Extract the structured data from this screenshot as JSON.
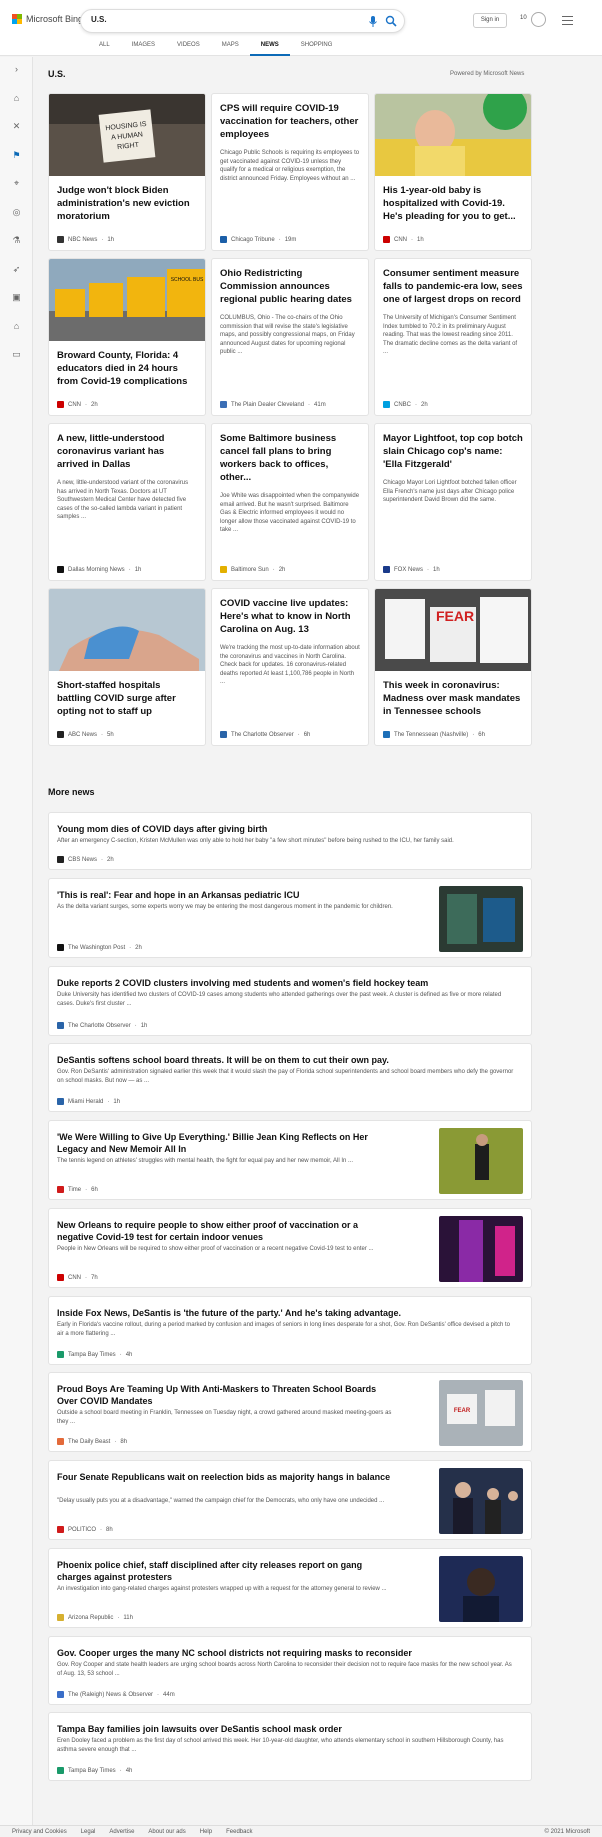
{
  "header": {
    "logo_text": "Microsoft Bing",
    "search_value": "U.S.",
    "signin_label": "Sign in",
    "points": "10"
  },
  "nav": [
    "ALL",
    "IMAGES",
    "VIDEOS",
    "MAPS",
    "NEWS",
    "SHOPPING"
  ],
  "nav_active": "NEWS",
  "section": {
    "title": "U.S.",
    "powered_by": "Powered by Microsoft News"
  },
  "cards": [
    {
      "title": "Judge won't block Biden administration's new eviction moratorium",
      "snippet": "",
      "source": "NBC News",
      "time": "1h"
    },
    {
      "title": "CPS will require COVID-19 vaccination for teachers, other employees",
      "snippet": "Chicago Public Schools is requiring its employees to get vaccinated against COVID-19 unless they qualify for a medical or religious exemption, the district announced Friday. Employees without an ...",
      "source": "Chicago Tribune",
      "time": "19m"
    },
    {
      "title": "His 1-year-old baby is hospitalized with Covid-19. He's pleading for you to get...",
      "snippet": "",
      "source": "CNN",
      "time": "1h"
    },
    {
      "title": "Broward County, Florida: 4 educators died in 24 hours from Covid-19 complications",
      "snippet": "",
      "source": "CNN",
      "time": "2h"
    },
    {
      "title": "Ohio Redistricting Commission announces regional public hearing dates",
      "snippet": "COLUMBUS, Ohio - The co-chairs of the Ohio commission that will revise the state's legislative maps, and possibly congressional maps, on Friday announced August dates for upcoming regional public ...",
      "source": "The Plain Dealer Cleveland",
      "time": "41m"
    },
    {
      "title": "Consumer sentiment measure falls to pandemic-era low, sees one of largest drops on record",
      "snippet": "The University of Michigan's Consumer Sentiment Index tumbled to 70.2 in its preliminary August reading. That was the lowest reading since 2011. The dramatic decline comes as the delta variant of ...",
      "source": "CNBC",
      "time": "2h"
    },
    {
      "title": "A new, little-understood coronavirus variant has arrived in Dallas",
      "snippet": "A new, little-understood variant of the coronavirus has arrived in North Texas. Doctors at UT Southwestern Medical Center have detected five cases of the so-called lambda variant in patient samples ...",
      "source": "Dallas Morning News",
      "time": "1h"
    },
    {
      "title": "Some Baltimore business cancel fall plans to bring workers back to offices, other...",
      "snippet": "Joe White was disappointed when the companywide email arrived. But he wasn't surprised. Baltimore Gas & Electric informed employees it would no longer allow those vaccinated against COVID-19 to take ...",
      "source": "Baltimore Sun",
      "time": "2h"
    },
    {
      "title": "Mayor Lightfoot, top cop botch slain Chicago cop's name: 'Ella Fitzgerald'",
      "snippet": "Chicago Mayor Lori Lightfoot botched fallen officer Ella French's name just days after Chicago police superintendent David Brown did the same.",
      "source": "FOX News",
      "time": "1h"
    },
    {
      "title": "Short-staffed hospitals battling COVID surge after opting not to staff up",
      "snippet": "",
      "source": "ABC News",
      "time": "5h"
    },
    {
      "title": "COVID vaccine live updates: Here's what to know in North Carolina on Aug. 13",
      "snippet": "We're tracking the most up-to-date information about the coronavirus and vaccines in North Carolina. Check back for updates. 16 coronavirus-related deaths reported At least 1,100,786 people in North ...",
      "source": "The Charlotte Observer",
      "time": "6h"
    },
    {
      "title": "This week in coronavirus: Madness over mask mandates in Tennessee schools",
      "snippet": "",
      "source": "The Tennessean (Nashville)",
      "time": "6h"
    }
  ],
  "images": {
    "sign_text": "HOUSING IS A HUMAN RIGHT",
    "bus_text": "SCHOOL BUS",
    "protest_text": "FEAR"
  },
  "more_news": {
    "title": "More news",
    "items": [
      {
        "title": "Young mom dies of COVID days after giving birth",
        "snippet": "After an emergency C-section, Kristen McMullen was only able to hold her baby \"a few short minutes\" before being rushed to the ICU, her family said.",
        "source": "CBS News",
        "time": "2h"
      },
      {
        "title": "'This is real': Fear and hope in an Arkansas pediatric ICU",
        "snippet": "As the delta variant surges, some experts worry we may be entering the most dangerous moment in the pandemic for children.",
        "source": "The Washington Post",
        "time": "2h"
      },
      {
        "title": "Duke reports 2 COVID clusters involving med students and women's field hockey team",
        "snippet": "Duke University has identified two clusters of COVID-19 cases among students who attended gatherings over the past week. A cluster is defined as five or more related cases. Duke's first cluster ...",
        "source": "The Charlotte Observer",
        "time": "1h"
      },
      {
        "title": "DeSantis softens school board threats. It will be on them to cut their own pay.",
        "snippet": "Gov. Ron DeSantis' administration signaled earlier this week that it would slash the pay of Florida school superintendents and school board members who defy the governor on school masks. But now — as ...",
        "source": "Miami Herald",
        "time": "1h"
      },
      {
        "title": "'We Were Willing to Give Up Everything.' Billie Jean King Reflects on Her Legacy and New Memoir All In",
        "snippet": "The tennis legend on athletes' struggles with mental health, the fight for equal pay and her new memoir, All In ...",
        "source": "Time",
        "time": "6h"
      },
      {
        "title": "New Orleans to require people to show either proof of vaccination or a negative Covid-19 test for certain indoor venues",
        "snippet": "People in New Orleans will be required to show either proof of vaccination or a recent negative Covid-19 test to enter ...",
        "source": "CNN",
        "time": "7h"
      },
      {
        "title": "Inside Fox News, DeSantis is 'the future of the party.' And he's taking advantage.",
        "snippet": "Early in Florida's vaccine rollout, during a period marked by confusion and images of seniors in long lines desperate for a shot, Gov. Ron DeSantis' office devised a pitch to air a more flattering ...",
        "source": "Tampa Bay Times",
        "time": "4h"
      },
      {
        "title": "Proud Boys Are Teaming Up With Anti-Maskers to Threaten School Boards Over COVID Mandates",
        "snippet": "Outside a school board meeting in Franklin, Tennessee on Tuesday night, a crowd gathered around masked meeting-goers as they ...",
        "source": "The Daily Beast",
        "time": "8h"
      },
      {
        "title": "Four Senate Republicans wait on reelection bids as majority hangs in balance",
        "snippet": "\"Delay usually puts you at a disadvantage,\" warned the campaign chief for the Democrats, who only have one undecided ...",
        "source": "POLITICO",
        "time": "8h"
      },
      {
        "title": "Phoenix police chief, staff disciplined after city releases report on gang charges against protesters",
        "snippet": "An investigation into gang-related charges against protesters wrapped up with a request for the attorney general to review ...",
        "source": "Arizona Republic",
        "time": "11h"
      },
      {
        "title": "Gov. Cooper urges the many NC school districts not requiring masks to reconsider",
        "snippet": "Gov. Roy Cooper and state health leaders are urging school boards across North Carolina to reconsider their decision not to require face masks for the new school year. As of Aug. 13, 53 school ...",
        "source": "The (Raleigh) News & Observer",
        "time": "44m"
      },
      {
        "title": "Tampa Bay families join lawsuits over DeSantis school mask order",
        "snippet": "Eren Dooley faced a problem as the first day of school arrived this week. Her 10-year-old daughter, who attends elementary school in southern Hillsborough County, has asthma severe enough that ...",
        "source": "Tampa Bay Times",
        "time": "4h"
      }
    ]
  },
  "footer": {
    "links": [
      "Privacy and Cookies",
      "Legal",
      "Advertise",
      "About our ads",
      "Help",
      "Feedback"
    ],
    "copyright": "© 2021 Microsoft"
  },
  "colors": {
    "accent": "#0c6ab7",
    "cnn": "#cc0000",
    "nbc": "#444444"
  }
}
